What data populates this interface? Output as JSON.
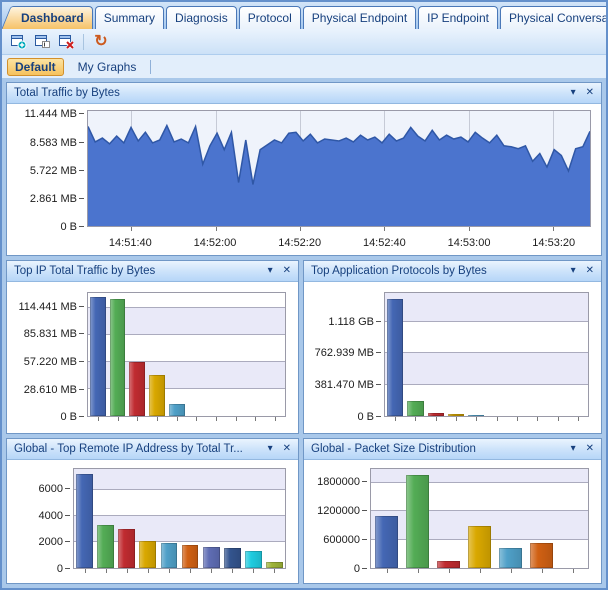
{
  "ui": {
    "collapse_glyph": "▾",
    "close_glyph": "✕"
  },
  "tabs": {
    "items": [
      {
        "label": "Dashboard",
        "active": true
      },
      {
        "label": "Summary"
      },
      {
        "label": "Diagnosis"
      },
      {
        "label": "Protocol"
      },
      {
        "label": "Physical Endpoint"
      },
      {
        "label": "IP Endpoint"
      },
      {
        "label": "Physical Conversation"
      }
    ],
    "scroll_left": "◁",
    "scroll_right": "▶"
  },
  "toolbar": {
    "buttons": [
      {
        "icon": "new-dashboard-window-icon"
      },
      {
        "icon": "rename-dashboard-window-icon"
      },
      {
        "icon": "delete-dashboard-window-icon"
      },
      {
        "icon": "reset-icon",
        "glyph": "↻"
      }
    ]
  },
  "subtabs": {
    "items": [
      {
        "label": "Default",
        "active": true
      },
      {
        "label": "My Graphs"
      }
    ]
  },
  "panels": [
    {
      "title": "Total Traffic by Bytes"
    },
    {
      "title": "Top IP Total Traffic by Bytes"
    },
    {
      "title": "Top Application Protocols by Bytes"
    },
    {
      "title": "Global - Top Remote IP Address by Total Tr..."
    },
    {
      "title": "Global - Packet Size Distribution"
    }
  ],
  "chart_data": [
    {
      "id": "total_traffic",
      "type": "area",
      "title": "Total Traffic by Bytes",
      "unit": "MB",
      "ylim": [
        0,
        11.9
      ],
      "plotmax": 11.9,
      "yticks": [
        {
          "label": "0 B",
          "value": 0
        },
        {
          "label": "2.861 MB",
          "value": 2.861
        },
        {
          "label": "5.722 MB",
          "value": 5.722
        },
        {
          "label": "8.583 MB",
          "value": 8.583
        },
        {
          "label": "11.444 MB",
          "value": 11.444
        }
      ],
      "xticks": [
        "14:51:40",
        "14:52:00",
        "14:52:20",
        "14:52:40",
        "14:53:00",
        "14:53:20"
      ],
      "xtick_fractions": [
        0.086,
        0.254,
        0.422,
        0.59,
        0.758,
        0.926
      ],
      "values": [
        10.3,
        8.7,
        9.1,
        8.5,
        9.3,
        8.6,
        10.2,
        8.8,
        9.7,
        8.6,
        8.9,
        10.4,
        8.7,
        9.0,
        8.6,
        10.3,
        6.4,
        8.3,
        9.6,
        7.9,
        9.7,
        4.5,
        8.9,
        4.3,
        7.9,
        8.4,
        8.9,
        8.6,
        9.6,
        9.7,
        8.8,
        9.5,
        8.6,
        9.0,
        8.9,
        8.8,
        9.1,
        8.7,
        9.4,
        8.9,
        9.2,
        8.6,
        9.5,
        8.8,
        9.1,
        10.2,
        9.3,
        8.8,
        9.9,
        8.9,
        9.4,
        9.0,
        9.2,
        8.7,
        9.7,
        9.1,
        8.6,
        9.4,
        8.3,
        8.2,
        8.0,
        8.3,
        6.7,
        7.5,
        6.1,
        7.9,
        7.3,
        5.7,
        8.0,
        8.2,
        9.8
      ],
      "fill": "#4B74CE",
      "stroke": "#2F57A6",
      "plot_bg": "#EFF3FB"
    },
    {
      "id": "top_ip",
      "type": "bar",
      "title": "Top IP Total Traffic by Bytes",
      "unit": "MB",
      "ylim": [
        0,
        130
      ],
      "plotmax": 130,
      "yticks": [
        {
          "label": "0 B",
          "value": 0
        },
        {
          "label": "28.610 MB",
          "value": 28.61
        },
        {
          "label": "57.220 MB",
          "value": 57.22
        },
        {
          "label": "85.831 MB",
          "value": 85.831
        },
        {
          "label": "114.441 MB",
          "value": 114.441
        }
      ],
      "slots": 10,
      "bar_frac": 0.8,
      "values": [
        126,
        124,
        57,
        43,
        13
      ],
      "colors": [
        "#4467B4",
        "#53AC55",
        "#C02B30",
        "#D9A800",
        "#4FA0C8"
      ]
    },
    {
      "id": "top_protocols",
      "type": "bar",
      "title": "Top Application Protocols by Bytes",
      "unit": "MB",
      "ylim": [
        0,
        1500
      ],
      "plotmax": 1500,
      "yticks": [
        {
          "label": "0 B",
          "value": 0
        },
        {
          "label": "381.470 MB",
          "value": 381.47
        },
        {
          "label": "762.939 MB",
          "value": 762.939
        },
        {
          "label": "1.118 GB",
          "value": 1144.41
        }
      ],
      "slots": 10,
      "bar_frac": 0.8,
      "values": [
        1430,
        180,
        42,
        22,
        16
      ],
      "colors": [
        "#4467B4",
        "#53AC55",
        "#C02B30",
        "#D9A800",
        "#4FA0C8"
      ]
    },
    {
      "id": "top_remote_ip",
      "type": "bar",
      "title": "Global - Top Remote IP Address by Total Tr...",
      "ylim": [
        0,
        7600
      ],
      "plotmax": 7600,
      "yticks": [
        {
          "label": "0",
          "value": 0
        },
        {
          "label": "2000",
          "value": 2000
        },
        {
          "label": "4000",
          "value": 4000
        },
        {
          "label": "6000",
          "value": 6000
        }
      ],
      "slots": 10,
      "bar_frac": 0.8,
      "values": [
        7250,
        3300,
        3000,
        2050,
        1950,
        1800,
        1650,
        1550,
        1280,
        480
      ],
      "colors": [
        "#4467B4",
        "#53AC55",
        "#C02B30",
        "#D9A800",
        "#4FA0C8",
        "#D06013",
        "#5F6DB4",
        "#33548E",
        "#1FCCE0",
        "#9EB438"
      ]
    },
    {
      "id": "packet_size",
      "type": "bar",
      "title": "Global - Packet Size Distribution",
      "ylim": [
        0,
        2100000
      ],
      "plotmax": 2100000,
      "yticks": [
        {
          "label": "0",
          "value": 0
        },
        {
          "label": "600000",
          "value": 600000
        },
        {
          "label": "1200000",
          "value": 1200000
        },
        {
          "label": "1800000",
          "value": 1800000
        }
      ],
      "slots": 7,
      "bar_frac": 0.74,
      "values": [
        1100000,
        1980000,
        150000,
        900000,
        430000,
        540000
      ],
      "colors": [
        "#4467B4",
        "#53AC55",
        "#C02B30",
        "#D9A800",
        "#4FA0C8",
        "#D06013"
      ]
    }
  ],
  "style": {
    "band_color": "#E9E9F8",
    "accent_orange": "#F6C268",
    "header_text": "#17407E",
    "dashboard_bg": "#A9C8EA"
  }
}
